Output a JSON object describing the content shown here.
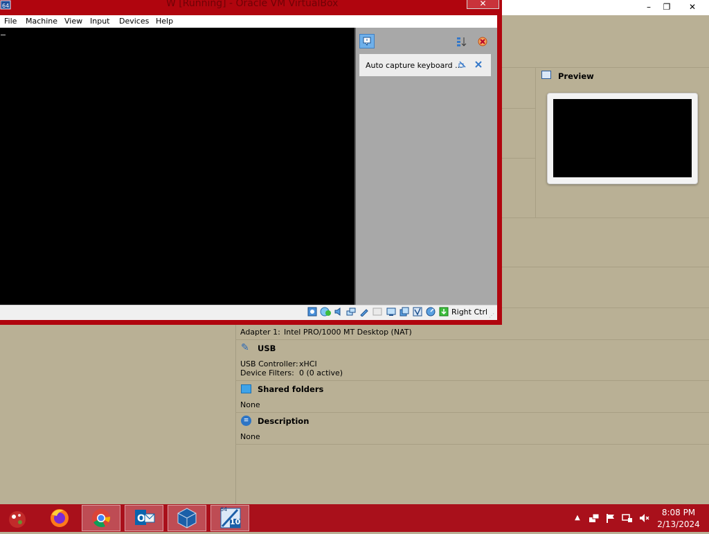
{
  "vm_window": {
    "title": "W   [Running] - Oracle VM VirtualBox",
    "close_icon": "close-icon",
    "menu": [
      "File",
      "Machine",
      "View",
      "Input",
      "Devices",
      "Help"
    ],
    "notification": {
      "text": "Auto capture keyboard ...",
      "icons": [
        "info-balloon-icon",
        "sort-icon",
        "dismiss-all-icon",
        "link-icon",
        "close-icon"
      ]
    },
    "statusbar": {
      "host_key": "Right Ctrl",
      "icons": [
        "hard-disk-icon",
        "optical-drive-icon",
        "audio-icon",
        "network-icon",
        "usb-icon",
        "shared-folders-icon",
        "display-icon",
        "recording-icon",
        "cpu-icon",
        "mouse-integration-icon",
        "keyboard-capture-icon"
      ]
    },
    "accent_color": "#b0050e"
  },
  "manager": {
    "window_buttons": [
      "minimize-icon",
      "restore-icon",
      "close-icon"
    ],
    "preview": {
      "title": "Preview",
      "icon": "monitor-icon"
    },
    "details": {
      "network_line": {
        "label": "Adapter 1:",
        "value": "Intel PRO/1000 MT Desktop (NAT)"
      },
      "usb": {
        "title": "USB",
        "rows": [
          {
            "label": "USB Controller:",
            "value": "xHCI"
          },
          {
            "label": "Device Filters:",
            "value": "0 (0 active)"
          }
        ]
      },
      "shared_folders": {
        "title": "Shared folders",
        "value": "None"
      },
      "description": {
        "title": "Description",
        "value": "None"
      }
    }
  },
  "taskbar": {
    "apps": [
      "start-button",
      "firefox-icon",
      "chrome-icon",
      "outlook-icon",
      "virtualbox-icon",
      "virtualbox-vm-icon"
    ],
    "vm_icon_labels": {
      "top": "64",
      "bottom": "10"
    },
    "tray_icons": [
      "show-hidden-icon",
      "network-icon",
      "flag-icon",
      "display-icon",
      "volume-muted-icon"
    ],
    "time": "8:08 PM",
    "date": "2/13/2024",
    "color": "#a9101b"
  }
}
